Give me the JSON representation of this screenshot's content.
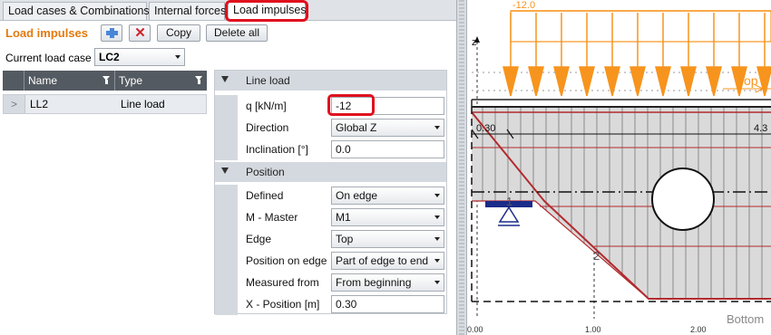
{
  "tabs": {
    "load_cases": "Load cases & Combinations",
    "internal_forces": "Internal forces",
    "load_impulses": "Load impulses"
  },
  "toolbar": {
    "heading": "Load impulses",
    "copy_label": "Copy",
    "delete_all_label": "Delete all"
  },
  "current_load_case": {
    "label": "Current load case",
    "value": "LC2"
  },
  "grid": {
    "columns": [
      "Name",
      "Type"
    ],
    "rows": [
      {
        "name": "LL2",
        "type": "Line load"
      }
    ]
  },
  "properties": {
    "line_load": {
      "title": "Line load",
      "q_label": "q [kN/m]",
      "q_value": "-12",
      "direction_label": "Direction",
      "direction_value": "Global Z",
      "inclination_label": "Inclination [°]",
      "inclination_value": "0.0"
    },
    "position": {
      "title": "Position",
      "defined_label": "Defined",
      "defined_value": "On edge",
      "master_label": "M - Master",
      "master_value": "M1",
      "edge_label": "Edge",
      "edge_value": "Top",
      "position_on_edge_label": "Position on edge",
      "position_on_edge_value": "Part of edge to end",
      "measured_from_label": "Measured from",
      "measured_from_value": "From beginning",
      "x_position_label": "X - Position [m]",
      "x_position_value": "0.30"
    }
  },
  "drawing": {
    "load_value": "-12.0",
    "top_label": "Top",
    "bottom_label": "Bottom",
    "dim_left": "0.30",
    "dim_right": "4.3",
    "node1": "1",
    "node2": "2",
    "axis_z": "z",
    "ticks": [
      "0.00",
      "1.00",
      "2.00"
    ],
    "colors": {
      "load": "#f7941d",
      "outline": "#b22a2e",
      "hatch": "#6e6e6e",
      "fill": "#d9d9d9",
      "support": "#1b2c8a"
    }
  }
}
